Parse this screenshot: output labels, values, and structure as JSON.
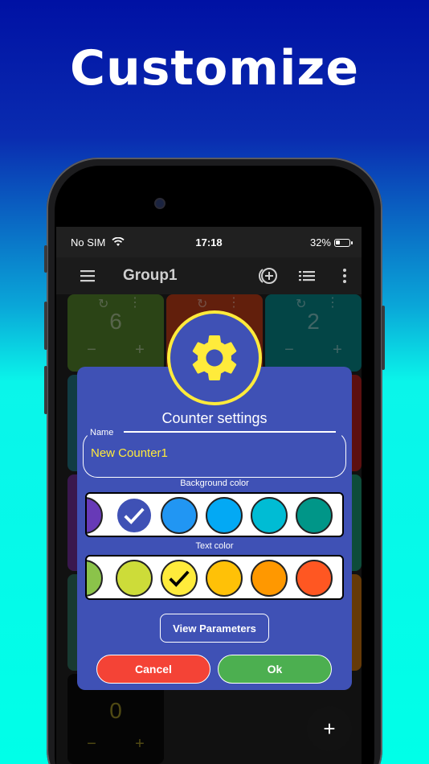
{
  "headline": "Customize",
  "status": {
    "carrier": "No SIM",
    "time": "17:18",
    "battery": "32%"
  },
  "appbar": {
    "title": "Group1",
    "menu_icon": "hamburger-menu-icon",
    "add_icon": "add-counter-icon",
    "list_icon": "list-view-icon",
    "more_icon": "more-vert-icon"
  },
  "tiles": [
    {
      "value": "6",
      "minus": "−",
      "plus": "+"
    },
    {
      "value": "2",
      "minus": "−",
      "plus": "+"
    },
    {
      "value": "0",
      "minus": "−",
      "plus": "+"
    }
  ],
  "dialog": {
    "title": "Counter settings",
    "name_label": "Name",
    "name_value": "New Counter1",
    "bg_label": "Background color",
    "text_label": "Text color",
    "view_params": "View Parameters",
    "cancel": "Cancel",
    "ok": "Ok"
  },
  "background_colors": [
    "#673ab7",
    "#3f51b5",
    "#2196f3",
    "#03a9f4",
    "#00bcd4",
    "#009688"
  ],
  "background_selected": 1,
  "text_colors": [
    "#8bc34a",
    "#cddc39",
    "#ffeb3b",
    "#ffc107",
    "#ff9800",
    "#ff5722"
  ],
  "text_selected": 2,
  "fab_label": "+"
}
